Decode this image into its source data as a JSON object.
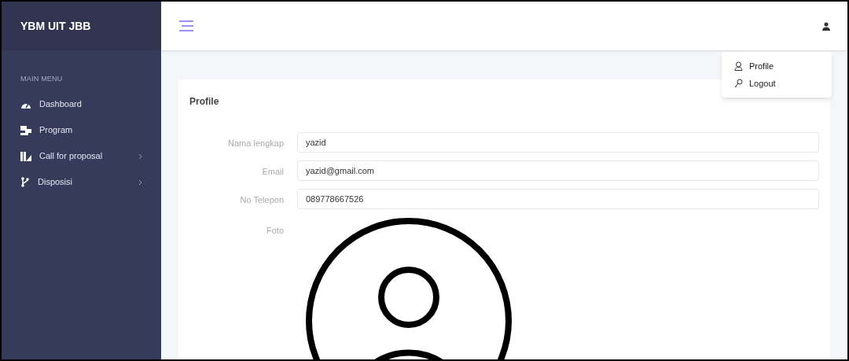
{
  "brand": "YBM UIT JBB",
  "sidebar": {
    "section": "MAIN MENU",
    "items": [
      {
        "label": "Dashboard",
        "has_submenu": false
      },
      {
        "label": "Program",
        "has_submenu": false
      },
      {
        "label": "Call for proposal",
        "has_submenu": true
      },
      {
        "label": "Disposisi",
        "has_submenu": true
      }
    ]
  },
  "user_menu": {
    "expanded": true,
    "items": [
      {
        "label": "Profile"
      },
      {
        "label": "Logout"
      }
    ]
  },
  "card": {
    "title": "Profile",
    "fields": [
      {
        "label": "Nama lengkap",
        "value": "yazid"
      },
      {
        "label": "Email",
        "value": "yazid@gmail.com"
      },
      {
        "label": "No Telepon",
        "value": "089778667526"
      }
    ],
    "photo_label": "Foto"
  }
}
